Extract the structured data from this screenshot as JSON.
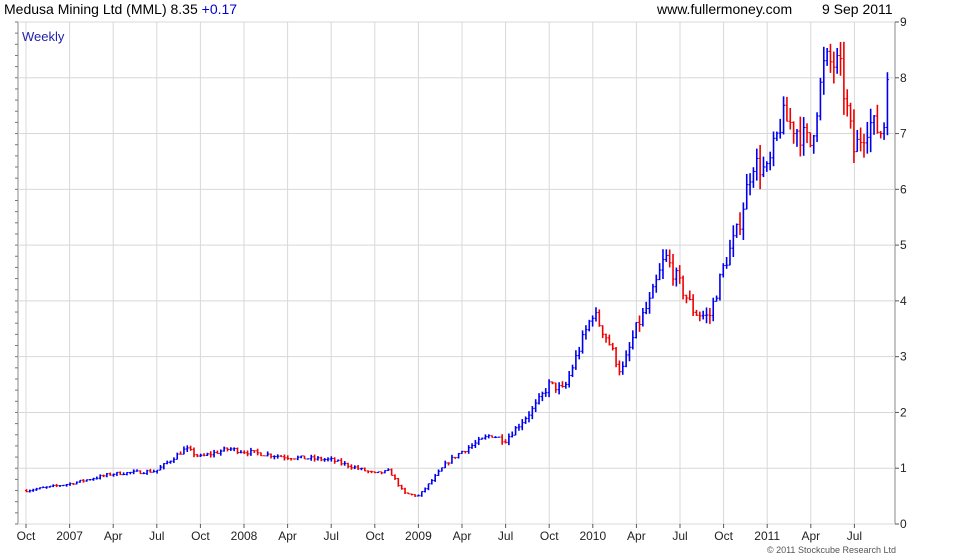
{
  "header": {
    "title": "Medusa Mining Ltd (MML) 8.35",
    "change": "+0.17",
    "website": "www.fullermoney.com",
    "date": "9 Sep 2011"
  },
  "footer": {
    "credit": "© 2011 Stockcube Research Ltd"
  },
  "colors": {
    "up": "#0000ee",
    "down": "#ee0000",
    "grid": "#d8d8d8",
    "label": "#2222aa"
  },
  "chart_data": {
    "type": "line",
    "title": "",
    "frequency_label": "Weekly",
    "xlabel": "",
    "ylabel": "",
    "ylim": [
      0,
      9
    ],
    "y_ticks": [
      0,
      1,
      2,
      3,
      4,
      5,
      6,
      7,
      8,
      9
    ],
    "y_axis_side": "right",
    "grid": true,
    "x_tick_labels": [
      "Oct",
      "2007",
      "Apr",
      "Jul",
      "Oct",
      "2008",
      "Apr",
      "Jul",
      "Oct",
      "2009",
      "Apr",
      "Jul",
      "Oct",
      "2010",
      "Apr",
      "Jul",
      "Oct",
      "2011",
      "Apr",
      "Jul"
    ],
    "series": [
      {
        "x": [
          "2006-10-02",
          "2006-12-31",
          "2007-03-31",
          "2007-06-30",
          "2007-08-31",
          "2007-09-30",
          "2007-11-30",
          "2007-12-31",
          "2008-03-31",
          "2008-06-30",
          "2008-09-30",
          "2008-10-31",
          "2008-11-30",
          "2008-12-31",
          "2009-02-28",
          "2009-03-31",
          "2009-05-31",
          "2009-06-30",
          "2009-08-31",
          "2009-09-30",
          "2009-10-31",
          "2009-11-30",
          "2009-12-31",
          "2010-01-31",
          "2010-02-28",
          "2010-03-31",
          "2010-04-30",
          "2010-05-31",
          "2010-06-30",
          "2010-07-31",
          "2010-08-31",
          "2010-09-30",
          "2010-10-31",
          "2010-11-30",
          "2010-12-31",
          "2011-01-31",
          "2011-02-28",
          "2011-03-31",
          "2011-04-30",
          "2011-05-31",
          "2011-06-30",
          "2011-07-31",
          "2011-08-31",
          "2011-09-09"
        ],
        "values": [
          0.6,
          0.72,
          0.9,
          0.95,
          1.35,
          1.2,
          1.35,
          1.3,
          1.2,
          1.15,
          0.9,
          0.95,
          0.55,
          0.5,
          1.1,
          1.3,
          1.6,
          1.5,
          2.1,
          2.5,
          2.4,
          3.1,
          3.8,
          3.3,
          2.7,
          3.5,
          4.0,
          4.8,
          4.3,
          3.8,
          3.7,
          4.6,
          5.3,
          6.5,
          6.3,
          7.3,
          7.1,
          6.8,
          8.3,
          8.2,
          6.7,
          7.2,
          7.0,
          8.35
        ]
      }
    ]
  }
}
